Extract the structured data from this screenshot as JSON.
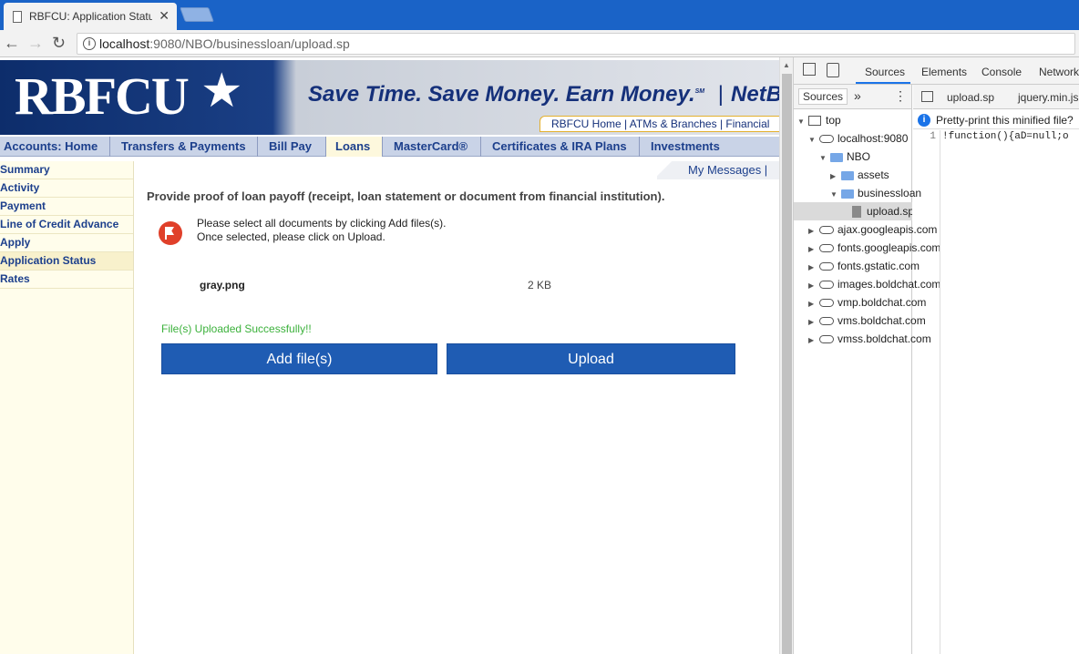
{
  "browser": {
    "tab_title": "RBFCU: Application Statu",
    "close_glyph": "✕",
    "url_host": "localhost",
    "url_rest": ":9080/NBO/businessloan/upload.sp",
    "back_glyph": "←",
    "forward_glyph": "→",
    "reload_glyph": "↻"
  },
  "banner": {
    "logo": "RBFCU",
    "slogan": "Save Time. Save Money. Earn Money.",
    "slogan_mark": "SM",
    "slogan_brand": "NetBran",
    "subnav": "RBFCU Home  |  ATMs & Branches  |  Financial"
  },
  "mainnav": [
    {
      "label": "Accounts: Home",
      "active": false
    },
    {
      "label": "Transfers & Payments",
      "active": false
    },
    {
      "label": "Bill Pay",
      "active": false
    },
    {
      "label": "Loans",
      "active": true
    },
    {
      "label": "MasterCard®",
      "active": false
    },
    {
      "label": "Certificates & IRA Plans",
      "active": false
    },
    {
      "label": "Investments",
      "active": false
    }
  ],
  "sidebar": [
    {
      "label": "Summary",
      "active": false
    },
    {
      "label": "Activity",
      "active": false
    },
    {
      "label": "Payment",
      "active": false
    },
    {
      "label": "Line of Credit Advance",
      "active": false
    },
    {
      "label": "Apply",
      "active": false
    },
    {
      "label": "Application Status",
      "active": true
    },
    {
      "label": "Rates",
      "active": false
    }
  ],
  "content": {
    "my_messages": "My Messages  |",
    "prompt": "Provide proof of loan payoff (receipt, loan statement or document from financial institution).",
    "instruction_line1": "Please select all documents by clicking Add files(s).",
    "instruction_line2": "Once selected, please click on Upload.",
    "file_name": "gray.png",
    "file_size": "2 KB",
    "success": "File(s) Uploaded Successfully!!",
    "add_button": "Add file(s)",
    "upload_button": "Upload"
  },
  "devtools": {
    "tabs": [
      "Sources",
      "Elements",
      "Console",
      "Network"
    ],
    "active_tab": "Sources",
    "nav_tab": "Sources",
    "more_glyph": "»",
    "kebab_glyph": "⋮",
    "editor_tabs": [
      "upload.sp",
      "jquery.min.js"
    ],
    "pretty_print": "Pretty-print this minified file?",
    "line_number": "1",
    "code": "!function(){aD=null;o",
    "tree": [
      {
        "label": "top",
        "type": "frame",
        "indent": 0,
        "open": true
      },
      {
        "label": "localhost:9080",
        "type": "cloud",
        "indent": 1,
        "open": true
      },
      {
        "label": "NBO",
        "type": "folder",
        "indent": 2,
        "open": true
      },
      {
        "label": "assets",
        "type": "folder",
        "indent": 3,
        "open": false
      },
      {
        "label": "businessloan",
        "type": "folder",
        "indent": 3,
        "open": true
      },
      {
        "label": "upload.sp",
        "type": "file",
        "indent": 4,
        "selected": true
      },
      {
        "label": "ajax.googleapis.com",
        "type": "cloud",
        "indent": 1,
        "open": false
      },
      {
        "label": "fonts.googleapis.com",
        "type": "cloud",
        "indent": 1,
        "open": false
      },
      {
        "label": "fonts.gstatic.com",
        "type": "cloud",
        "indent": 1,
        "open": false
      },
      {
        "label": "images.boldchat.com",
        "type": "cloud",
        "indent": 1,
        "open": false
      },
      {
        "label": "vmp.boldchat.com",
        "type": "cloud",
        "indent": 1,
        "open": false
      },
      {
        "label": "vms.boldchat.com",
        "type": "cloud",
        "indent": 1,
        "open": false
      },
      {
        "label": "vmss.boldchat.com",
        "type": "cloud",
        "indent": 1,
        "open": false
      }
    ]
  },
  "colors": {
    "chrome_blue": "#1a63c7",
    "nav_text": "#1c3f8c",
    "button_blue": "#1f5cb3",
    "success_green": "#3bb13b",
    "alert_red": "#e0402a"
  }
}
